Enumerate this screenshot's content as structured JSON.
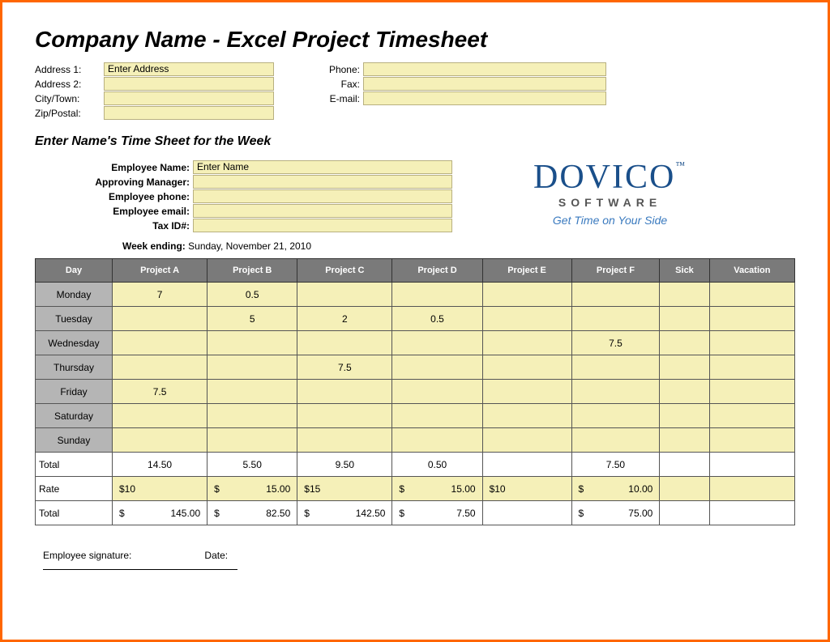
{
  "title": "Company Name - Excel Project Timesheet",
  "company_labels": {
    "address1": "Address 1:",
    "address2": "Address 2:",
    "city": "City/Town:",
    "zip": "Zip/Postal:",
    "phone": "Phone:",
    "fax": "Fax:",
    "email": "E-mail:"
  },
  "company_values": {
    "address1": "Enter Address",
    "address2": "",
    "city": "",
    "zip": "",
    "phone": "",
    "fax": "",
    "email": ""
  },
  "subtitle": "Enter Name's Time Sheet for the Week",
  "emp_labels": {
    "name": "Employee Name:",
    "manager": "Approving Manager:",
    "phone": "Employee phone:",
    "email": "Employee email:",
    "tax": "Tax ID#:"
  },
  "emp_values": {
    "name": "Enter Name",
    "manager": "",
    "phone": "",
    "email": "",
    "tax": ""
  },
  "brand": {
    "name": "DOVICO",
    "tm": "™",
    "subtitle": "SOFTWARE",
    "tagline": "Get Time on Your Side"
  },
  "week_ending": {
    "label": "Week ending:",
    "value": "Sunday, November 21, 2010"
  },
  "headers": [
    "Day",
    "Project A",
    "Project B",
    "Project C",
    "Project D",
    "Project E",
    "Project F",
    "Sick",
    "Vacation"
  ],
  "days": [
    "Monday",
    "Tuesday",
    "Wednesday",
    "Thursday",
    "Friday",
    "Saturday",
    "Sunday"
  ],
  "cells": {
    "Monday": [
      "7",
      "0.5",
      "",
      "",
      "",
      "",
      "",
      ""
    ],
    "Tuesday": [
      "",
      "5",
      "2",
      "0.5",
      "",
      "",
      "",
      ""
    ],
    "Wednesday": [
      "",
      "",
      "",
      "",
      "",
      "7.5",
      "",
      ""
    ],
    "Thursday": [
      "",
      "",
      "7.5",
      "",
      "",
      "",
      "",
      ""
    ],
    "Friday": [
      "7.5",
      "",
      "",
      "",
      "",
      "",
      "",
      ""
    ],
    "Saturday": [
      "",
      "",
      "",
      "",
      "",
      "",
      "",
      ""
    ],
    "Sunday": [
      "",
      "",
      "",
      "",
      "",
      "",
      "",
      ""
    ]
  },
  "summary_labels": {
    "total": "Total",
    "rate": "Rate"
  },
  "totals_hours": [
    "14.50",
    "5.50",
    "9.50",
    "0.50",
    "",
    "7.50",
    "",
    ""
  ],
  "rates": [
    {
      "s": "$10"
    },
    {
      "s": "$",
      "v": "15.00"
    },
    {
      "s": "$15"
    },
    {
      "s": "$",
      "v": "15.00"
    },
    {
      "s": "$10"
    },
    {
      "s": "$",
      "v": "10.00"
    },
    {},
    {}
  ],
  "totals_money": [
    {
      "s": "$",
      "v": "145.00"
    },
    {
      "s": "$",
      "v": "82.50"
    },
    {
      "s": "$",
      "v": "142.50"
    },
    {
      "s": "$",
      "v": "7.50"
    },
    {},
    {
      "s": "$",
      "v": "75.00"
    },
    {},
    {}
  ],
  "signature": {
    "emp": "Employee signature:",
    "date": "Date:"
  }
}
